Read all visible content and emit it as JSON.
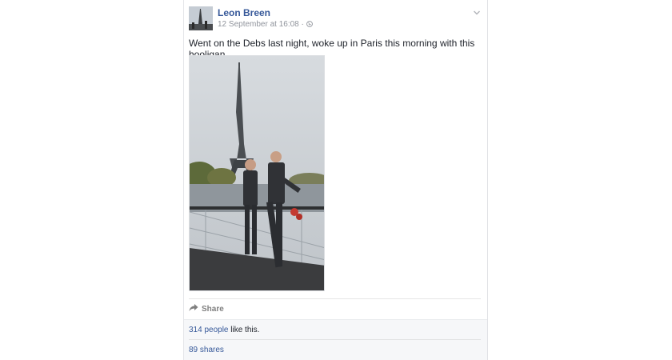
{
  "post": {
    "author": "Leon Breen",
    "timestamp": "12 September at 16:08",
    "separator": "·",
    "privacy_icon": "globe-icon",
    "menu_icon": "chevron-down-icon",
    "text": "Went on the Debs last night, woke up in Paris this morning with this hooligan."
  },
  "actions": {
    "share_label": "Share",
    "share_icon": "share-arrow-icon"
  },
  "ufi": {
    "likes_count": "314 people",
    "likes_suffix": " like this.",
    "shares": "89 shares"
  },
  "colors": {
    "link": "#365899",
    "meta": "#90949c",
    "text": "#1d2129",
    "ufi_bg": "#f6f7f9"
  }
}
